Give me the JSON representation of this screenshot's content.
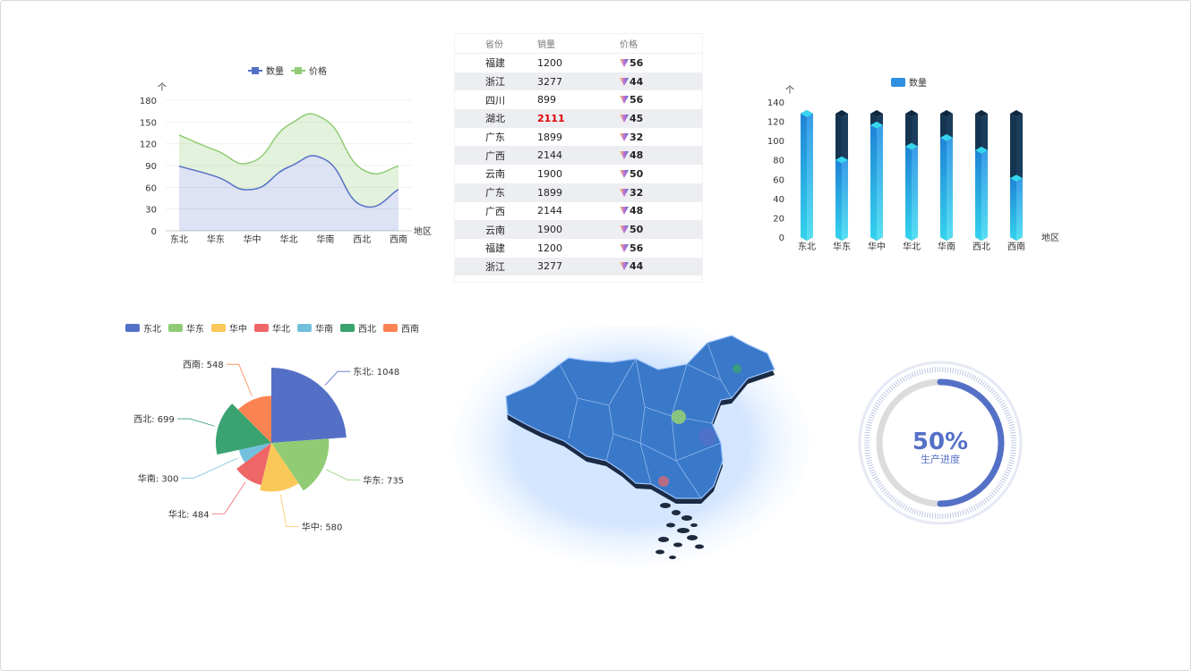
{
  "line_chart": {
    "legend": [
      {
        "name": "数量",
        "color": "#5470c6"
      },
      {
        "name": "价格",
        "color": "#91cc75"
      }
    ],
    "y_unit": "个",
    "x_name": "地区",
    "y_ticks": [
      "0",
      "30",
      "60",
      "90",
      "120",
      "150",
      "180"
    ]
  },
  "table": {
    "headers": [
      "省份",
      "销量",
      "价格"
    ],
    "rows": [
      {
        "province": "福建",
        "sales": "1200",
        "price": "56",
        "highlight": false
      },
      {
        "province": "浙江",
        "sales": "3277",
        "price": "44",
        "highlight": false
      },
      {
        "province": "四川",
        "sales": "899",
        "price": "56",
        "highlight": false
      },
      {
        "province": "湖北",
        "sales": "2111",
        "price": "45",
        "highlight": true
      },
      {
        "province": "广东",
        "sales": "1899",
        "price": "32",
        "highlight": false
      },
      {
        "province": "广西",
        "sales": "2144",
        "price": "48",
        "highlight": false
      },
      {
        "province": "云南",
        "sales": "1900",
        "price": "50",
        "highlight": false
      },
      {
        "province": "广东",
        "sales": "1899",
        "price": "32",
        "highlight": false
      },
      {
        "province": "广西",
        "sales": "2144",
        "price": "48",
        "highlight": false
      },
      {
        "province": "云南",
        "sales": "1900",
        "price": "50",
        "highlight": false
      },
      {
        "province": "福建",
        "sales": "1200",
        "price": "56",
        "highlight": false
      },
      {
        "province": "浙江",
        "sales": "3277",
        "price": "44",
        "highlight": false
      }
    ]
  },
  "bar_chart": {
    "legend": "数量",
    "y_unit": "个",
    "x_name": "地区",
    "y_ticks": [
      "0",
      "20",
      "40",
      "60",
      "80",
      "100",
      "120",
      "140"
    ]
  },
  "pie_legend": [
    {
      "name": "东北",
      "color": "#5470c6"
    },
    {
      "name": "华东",
      "color": "#91cc75"
    },
    {
      "name": "华中",
      "color": "#fac858"
    },
    {
      "name": "华北",
      "color": "#ee6666"
    },
    {
      "name": "华南",
      "color": "#73c0de"
    },
    {
      "name": "西北",
      "color": "#3ba272"
    },
    {
      "name": "西南",
      "color": "#fc8452"
    }
  ],
  "gauge": {
    "value_text": "50%",
    "label": "生产进度",
    "value": 0.5,
    "color": "#5470c6"
  },
  "chart_data": [
    {
      "type": "area",
      "categories": [
        "东北",
        "华东",
        "华中",
        "华北",
        "华南",
        "西北",
        "西南"
      ],
      "series": [
        {
          "name": "数量",
          "values": [
            89,
            75,
            57,
            88,
            98,
            35,
            57
          ],
          "color": "#5470c6"
        },
        {
          "name": "价格",
          "values": [
            43,
            36,
            38,
            58,
            55,
            50,
            32
          ],
          "color": "#91cc75"
        }
      ],
      "stacked": true,
      "ylim": [
        0,
        180
      ],
      "ylabel": "个",
      "xlabel": "地区",
      "legend": "top"
    },
    {
      "type": "bar",
      "categories": [
        "东北",
        "华东",
        "华中",
        "华北",
        "华南",
        "西北",
        "西南"
      ],
      "series": [
        {
          "name": "数量",
          "values": [
            128,
            80,
            116,
            94,
            103,
            90,
            61
          ]
        }
      ],
      "ylim": [
        0,
        140
      ],
      "ylabel": "个",
      "xlabel": "地区",
      "legend": "top"
    },
    {
      "type": "pie",
      "rose": true,
      "labels": [
        "东北",
        "华东",
        "华中",
        "华北",
        "华南",
        "西北",
        "西南"
      ],
      "values": [
        1048,
        735,
        580,
        484,
        300,
        699,
        548
      ],
      "legend": "top"
    }
  ]
}
